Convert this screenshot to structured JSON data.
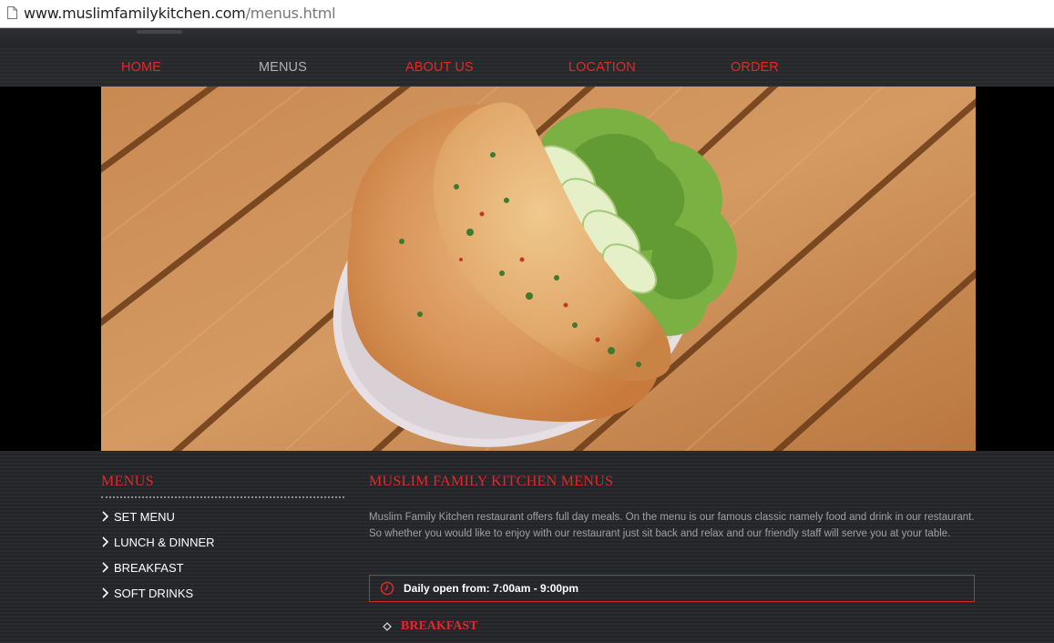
{
  "browser": {
    "url_domain": "www.muslimfamilykitchen.com",
    "url_path": "/menus.html",
    "page_icon": "page-icon"
  },
  "nav": {
    "items": [
      {
        "label": "HOME",
        "active": false
      },
      {
        "label": "MENUS",
        "active": true
      },
      {
        "label": "ABOUT US",
        "active": false
      },
      {
        "label": "LOCATION",
        "active": false
      },
      {
        "label": "ORDER",
        "active": false
      }
    ]
  },
  "hero": {
    "image": "omelette-plate-photo",
    "description_icon": "food-photo"
  },
  "sidebar": {
    "title": "MENUS",
    "items": [
      {
        "label": "SET MENU",
        "icon": "chevron-right-icon"
      },
      {
        "label": "LUNCH & DINNER",
        "icon": "chevron-right-icon"
      },
      {
        "label": "BREAKFAST",
        "icon": "chevron-right-icon"
      },
      {
        "label": "SOFT DRINKS",
        "icon": "chevron-right-icon"
      }
    ]
  },
  "main": {
    "title": "MUSLIM FAMILY KITCHEN MENUS",
    "intro": "Muslim Family Kitchen restaurant offers full day  meals. On the menu is our famous classic namely food and drink in our restaurant. So whether you would like to enjoy with our restaurant just sit back and relax and our friendly staff will serve you at your table.",
    "hours": "Daily open from: 7:00am - 9:00pm",
    "hours_icon": "clock-icon",
    "section_heading": "BREAKFAST",
    "section_icon": "diamond-bullet-icon"
  },
  "colors": {
    "accent": "#e02a2a",
    "nav_active": "#b0b0b0",
    "background": "#232427",
    "text_muted": "#a0a0a0"
  }
}
